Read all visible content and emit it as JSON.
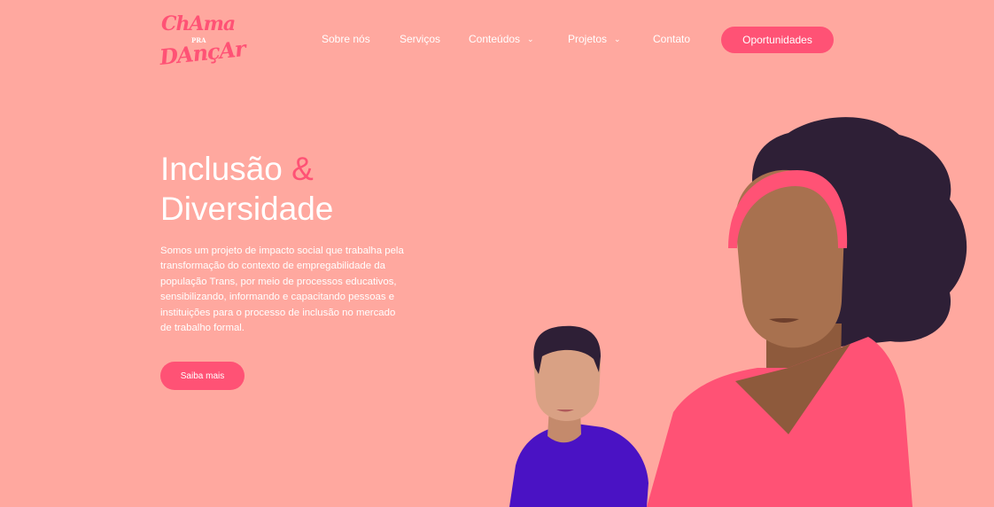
{
  "logo": {
    "line1": "ChAma",
    "line2": "PRA",
    "line3": "DAnçAr"
  },
  "nav": {
    "items": [
      {
        "label": "Sobre nós",
        "has_dropdown": false
      },
      {
        "label": "Serviços",
        "has_dropdown": false
      },
      {
        "label": "Conteúdos",
        "has_dropdown": true
      },
      {
        "label": "Projetos",
        "has_dropdown": true
      },
      {
        "label": "Contato",
        "has_dropdown": false
      }
    ],
    "cta_label": "Oportunidades"
  },
  "hero": {
    "title_line1_text": "Inclusão",
    "title_line1_amp": "&",
    "title_line2": "Diversidade",
    "paragraph_lines": [
      "Somos um projeto de impacto social que trabalha pela",
      "transformação do contexto de empregabilidade da",
      "população Trans, por meio de processos educativos,",
      "sensibilizando, informando e capacitando pessoas e",
      "instituições para o processo de inclusão no mercado",
      "de trabalho formal."
    ],
    "button_label": "Saiba mais"
  },
  "icons": {
    "dropdown": "chevron-down-icon"
  },
  "colors": {
    "background": "#ffa89f",
    "accent": "#ff5275",
    "text": "#ffffff",
    "hair": "#2e1f36",
    "skin_dark": "#a8714f",
    "skin_light": "#d9a184",
    "shirt_purple": "#4a12c4"
  }
}
